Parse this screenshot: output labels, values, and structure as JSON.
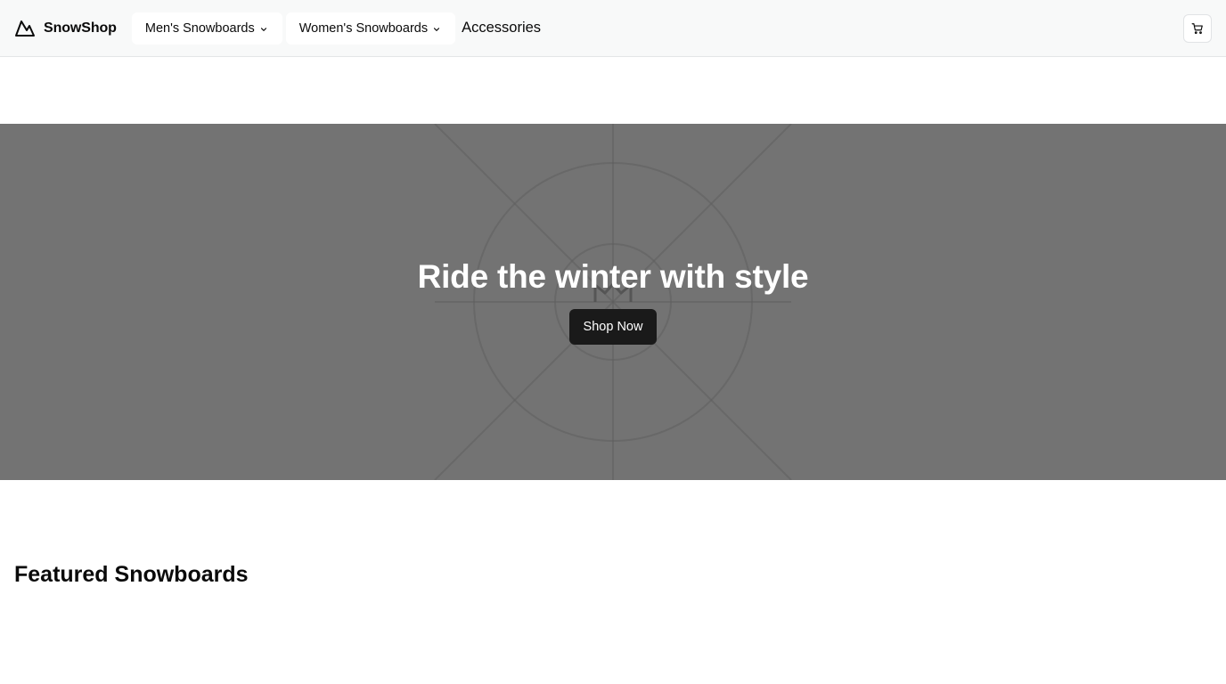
{
  "header": {
    "brand": {
      "name": "SnowShop",
      "icon": "mountain-logo-icon"
    },
    "nav": {
      "mens_label": "Men's Snowboards",
      "womens_label": "Women's Snowboards",
      "accessories_label": "Accessories",
      "dropdown_icon": "chevron-down-icon"
    },
    "cart": {
      "icon": "shopping-cart-icon"
    }
  },
  "hero": {
    "title": "Ride the winter with style",
    "cta_label": "Shop Now",
    "image_placeholder_icon": "image-placeholder-icon"
  },
  "featured": {
    "title": "Featured Snowboards"
  },
  "colors": {
    "header_bg": "#f8f9f9",
    "hero_bg": "#737373",
    "cta_bg": "#1a1a1a",
    "text_primary": "#0a0a0a",
    "text_inverse": "#ffffff"
  }
}
